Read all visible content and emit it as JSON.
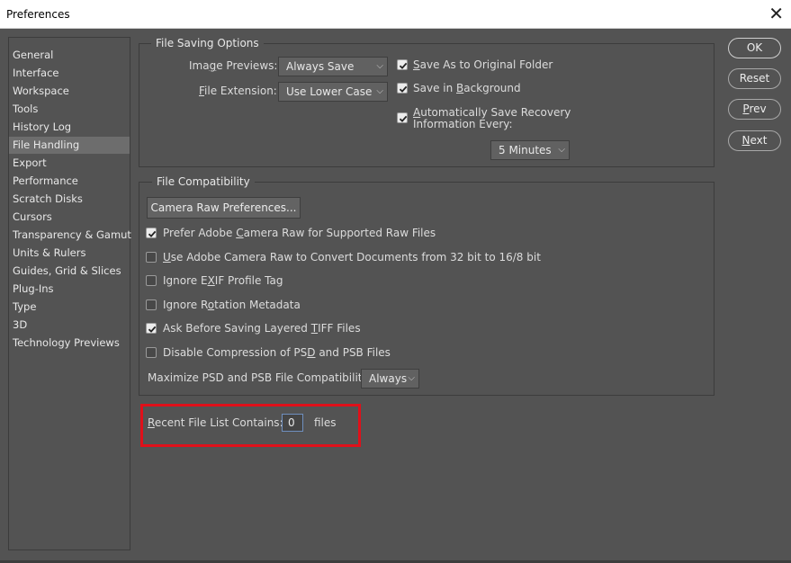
{
  "window": {
    "title": "Preferences",
    "close_glyph": "✕"
  },
  "sidebar": {
    "items": [
      {
        "label": "General"
      },
      {
        "label": "Interface"
      },
      {
        "label": "Workspace"
      },
      {
        "label": "Tools"
      },
      {
        "label": "History Log"
      },
      {
        "label": "File Handling",
        "selected": true
      },
      {
        "label": "Export"
      },
      {
        "label": "Performance"
      },
      {
        "label": "Scratch Disks"
      },
      {
        "label": "Cursors"
      },
      {
        "label": "Transparency & Gamut"
      },
      {
        "label": "Units & Rulers"
      },
      {
        "label": "Guides, Grid & Slices"
      },
      {
        "label": "Plug-Ins"
      },
      {
        "label": "Type"
      },
      {
        "label": "3D"
      },
      {
        "label": "Technology Previews"
      }
    ]
  },
  "file_saving": {
    "title": "File Saving Options",
    "image_previews": {
      "label_pre": "Ima",
      "label_u": "g",
      "label_post": "e Previews:",
      "value": "Always Save"
    },
    "file_extension": {
      "label_u": "F",
      "label_post": "ile Extension:",
      "value": "Use Lower Case"
    },
    "save_as_original": {
      "label_u": "S",
      "label_post": "ave As to Original Folder",
      "checked": true
    },
    "save_background": {
      "label_pre": "Save in ",
      "label_u": "B",
      "label_post": "ackground",
      "checked": true
    },
    "auto_save": {
      "label_line1_u": "A",
      "label_line1_post": "utomatically Save Recovery",
      "label_line2": "Information Every:",
      "checked": true,
      "interval": "5 Minutes"
    }
  },
  "compat": {
    "title": "File Compatibility",
    "camera_raw_button": "Camera Raw Preferences...",
    "prefer_acr": {
      "pre": "Prefer Adobe ",
      "u": "C",
      "post": "amera Raw for Supported Raw Files",
      "checked": true
    },
    "use_acr_convert": {
      "pre": "",
      "u": "U",
      "post": "se Adobe Camera Raw to Convert Documents from 32 bit to 16/8 bit",
      "checked": false
    },
    "ignore_exif": {
      "pre": "Ignore E",
      "u": "X",
      "post": "IF Profile Tag",
      "checked": false
    },
    "ignore_rotation": {
      "pre": "Ignore R",
      "u": "o",
      "post": "tation Metadata",
      "checked": false
    },
    "ask_tiff": {
      "pre": "Ask Before Saving Layered ",
      "u": "T",
      "post": "IFF Files",
      "checked": true
    },
    "disable_compression": {
      "pre": "Disable Compression of PS",
      "u": "D",
      "post": " and PSB Files",
      "checked": false
    },
    "maximize": {
      "label": "Maximize PSD and PSB File Compatibility:",
      "value": "Always"
    }
  },
  "recent": {
    "label_u": "R",
    "label_post": "ecent File List Contains:",
    "value": "0",
    "suffix": "files"
  },
  "buttons": {
    "ok": "OK",
    "reset": "Reset",
    "prev_u": "P",
    "prev_post": "rev",
    "next_u": "N",
    "next_post": "ext"
  },
  "colors": {
    "background": "#535353",
    "highlight": "#e0101a"
  }
}
